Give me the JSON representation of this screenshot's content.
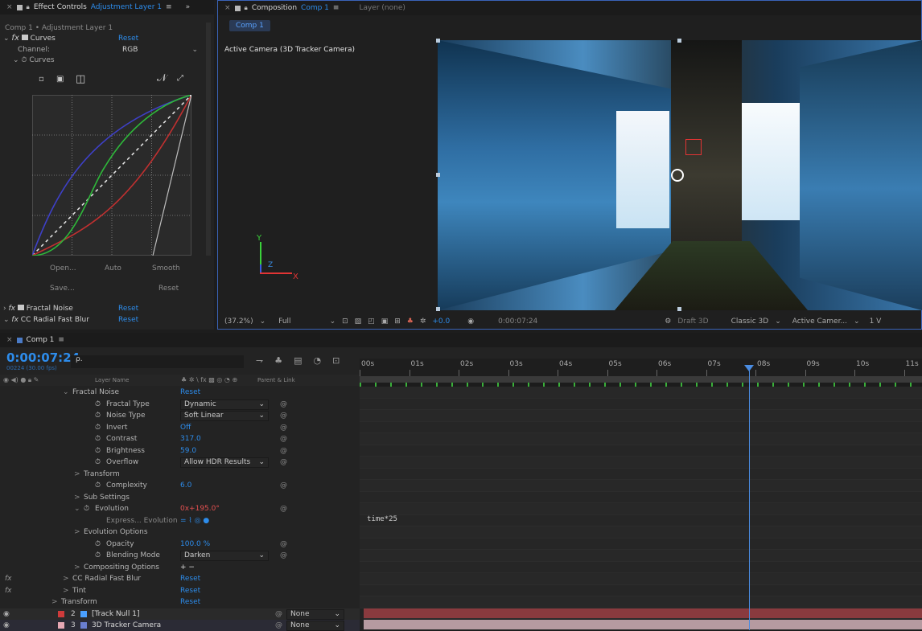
{
  "effect_panel": {
    "tab_title": "Effect Controls",
    "tab_layer": "Adjustment Layer 1",
    "breadcrumb": "Comp 1 • Adjustment Layer 1",
    "fx_icon": "fx",
    "curves_name": "Curves",
    "reset": "Reset",
    "channel_label": "Channel:",
    "channel_value": "RGB",
    "curves_sub": "Curves",
    "btn_open": "Open...",
    "btn_auto": "Auto",
    "btn_smooth": "Smooth",
    "btn_save": "Save...",
    "btn_reset": "Reset",
    "fractal": "Fractal Noise",
    "ccradial": "CC Radial Fast Blur"
  },
  "comp_panel": {
    "tab_title": "Composition",
    "tab_comp": "Comp 1",
    "layer_tab": "Layer (none)",
    "comp_chip": "Comp 1",
    "camera_label": "Active Camera (3D Tracker Camera)",
    "axis_y": "Y",
    "axis_z": "Z",
    "axis_x": "X",
    "zoom": "(37.2%)",
    "resolution": "Full",
    "exposure": "+0.0",
    "timecode": "0:00:07:24",
    "draft": "Draft 3D",
    "renderer": "Classic 3D",
    "view": "Active Camer...",
    "views": "1 V"
  },
  "timeline": {
    "tab": "Comp 1",
    "timecode": "0:00:07:24",
    "fps": "00224 (30.00 fps)",
    "search": "ρ.",
    "col_layer": "Layer Name",
    "col_switches": "♣ ✲ \\ fx ▩ ◎ ◔ ⊕",
    "col_parent": "Parent & Link",
    "ruler": [
      "00s",
      "01s",
      "02s",
      "03s",
      "04s",
      "05s",
      "06s",
      "07s",
      "08s",
      "09s",
      "10s",
      "11s"
    ],
    "props": [
      {
        "label": "Fractal Noise",
        "value": "Reset",
        "vtype": "blue",
        "indent": 90,
        "arrow": "⌄"
      },
      {
        "label": "Fractal Type",
        "value": "Dynamic",
        "vtype": "dd",
        "indent": 118,
        "sw": true
      },
      {
        "label": "Noise Type",
        "value": "Soft Linear",
        "vtype": "dd",
        "indent": 118,
        "sw": true
      },
      {
        "label": "Invert",
        "value": "Off",
        "vtype": "blue",
        "indent": 118,
        "sw": true
      },
      {
        "label": "Contrast",
        "value": "317.0",
        "vtype": "blue",
        "indent": 118,
        "sw": true
      },
      {
        "label": "Brightness",
        "value": "59.0",
        "vtype": "blue",
        "indent": 118,
        "sw": true
      },
      {
        "label": "Overflow",
        "value": "Allow HDR Results",
        "vtype": "dd",
        "indent": 118,
        "sw": true
      },
      {
        "label": "Transform",
        "value": "",
        "vtype": "",
        "indent": 104,
        "arrow": ">"
      },
      {
        "label": "Complexity",
        "value": "6.0",
        "vtype": "blue",
        "indent": 118,
        "sw": true
      },
      {
        "label": "Sub Settings",
        "value": "",
        "vtype": "",
        "indent": 104,
        "arrow": ">"
      },
      {
        "label": "Evolution",
        "value": "0x+195.0°",
        "vtype": "red",
        "indent": 104,
        "arrow": "⌄",
        "sw": true
      },
      {
        "label": "Express... Evolution",
        "value": "= ⌇ ◎ ●",
        "vtype": "blue",
        "indent": 132
      },
      {
        "label": "Evolution Options",
        "value": "",
        "vtype": "",
        "indent": 104,
        "arrow": ">"
      },
      {
        "label": "Opacity",
        "value": "100.0 %",
        "vtype": "blue",
        "indent": 118,
        "sw": true
      },
      {
        "label": "Blending Mode",
        "value": "Darken",
        "vtype": "dd",
        "indent": 118,
        "sw": true
      },
      {
        "label": "Compositing Options",
        "value": "+ −",
        "vtype": "plain",
        "indent": 104,
        "arrow": ">"
      },
      {
        "label": "CC Radial Fast Blur",
        "value": "Reset",
        "vtype": "blue",
        "indent": 90,
        "arrow": ">",
        "fx": true
      },
      {
        "label": "Tint",
        "value": "Reset",
        "vtype": "blue",
        "indent": 90,
        "arrow": ">",
        "fx": true
      },
      {
        "label": "Transform",
        "value": "Reset",
        "vtype": "blue",
        "indent": 76,
        "arrow": ">"
      }
    ],
    "layers": [
      {
        "num": "2",
        "name": "[Track Null 1]",
        "color": "#cf3b3b",
        "parent": "None"
      },
      {
        "num": "3",
        "name": "3D Tracker Camera",
        "color": "#e6a8b4",
        "parent": "None"
      }
    ],
    "expression": "time*25"
  },
  "colors": {
    "accent": "#2d8ceb",
    "keyframe_red": "#e35050",
    "layer_red": "#8a3a3e",
    "layer_pink": "#b69aa0"
  }
}
